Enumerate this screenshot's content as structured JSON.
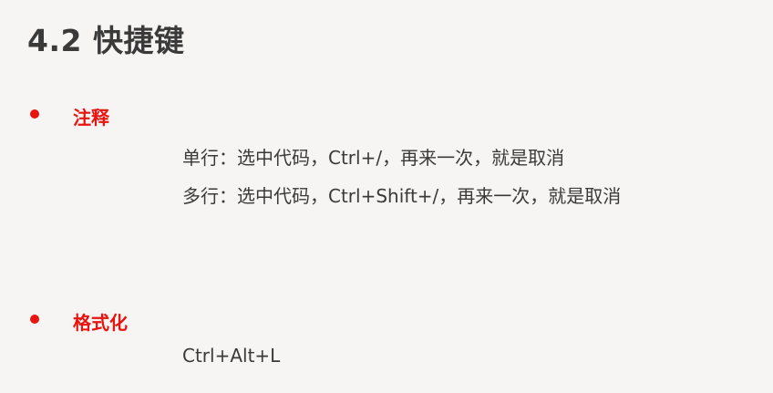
{
  "slide": {
    "title": "4.2 快捷键",
    "sections": [
      {
        "heading": "注释",
        "lines": [
          "单行：选中代码，Ctrl+/，再来一次，就是取消",
          "多行：选中代码，Ctrl+Shift+/，再来一次，就是取消"
        ]
      },
      {
        "heading": "格式化",
        "lines": [
          "Ctrl+Alt+L"
        ]
      }
    ]
  },
  "colors": {
    "accent": "#e8140f",
    "text": "#3a3a3a",
    "background": "#f6f5f4"
  }
}
